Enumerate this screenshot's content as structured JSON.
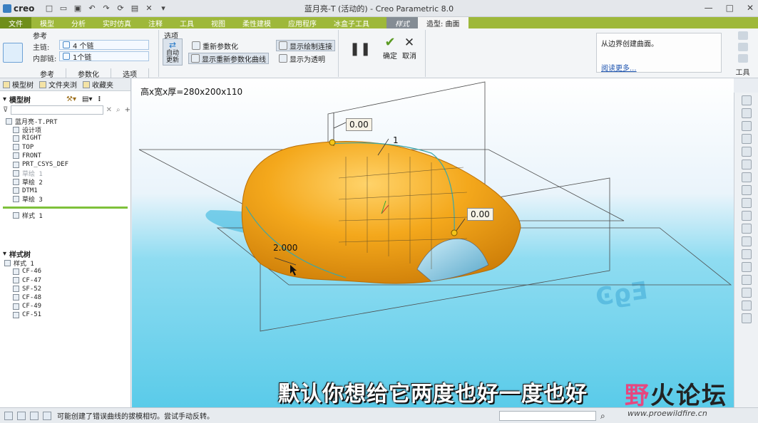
{
  "app": {
    "logo": "creo",
    "window_title": "蓝月亮-T (活动的) - Creo Parametric 8.0"
  },
  "menu": {
    "items": [
      "文件",
      "模型",
      "分析",
      "实时仿真",
      "注释",
      "工具",
      "视图",
      "柔性建模",
      "应用程序",
      "冰盒子工具"
    ],
    "style_tab": "样式",
    "active_tab": "造型: 曲面"
  },
  "ribbon": {
    "reference": {
      "title": "参考",
      "main_chain_label": "主链:",
      "main_chain_value": "4 个链",
      "inner_chain_label": "内部链:",
      "inner_chain_value": "1个链"
    },
    "options": {
      "title": "选项",
      "auto_update": "自动更新",
      "reparam": "重新参数化",
      "show_reparam_curves": "显示重新参数化曲线",
      "show_draw_connection": "显示绘制连接",
      "show_transparent": "显示为透明"
    },
    "ok_label": "确定",
    "cancel_label": "取消",
    "bottom_tabs": [
      "参考",
      "参数化",
      "选项"
    ],
    "help_text": "从边界创建曲面。",
    "help_link": "阅读更多...",
    "tools_label": "工具"
  },
  "left_panel": {
    "tabs": [
      "模型树",
      "文件夹浏",
      "收藏夹"
    ],
    "model_tree_title": "模型树",
    "model_tree": [
      {
        "label": "蓝月亮-T.PRT",
        "dim": false
      },
      {
        "label": "设计项",
        "dim": false
      },
      {
        "label": "RIGHT",
        "dim": false
      },
      {
        "label": "TOP",
        "dim": false
      },
      {
        "label": "FRONT",
        "dim": false
      },
      {
        "label": "PRT_CSYS_DEF",
        "dim": false
      },
      {
        "label": "草绘 1",
        "dim": true
      },
      {
        "label": "草绘 2",
        "dim": false
      },
      {
        "label": "DTM1",
        "dim": false
      },
      {
        "label": "草绘 3",
        "dim": false
      }
    ],
    "active_feature": "样式 1",
    "style_tree_title": "样式树",
    "style_tree": [
      "样式 1",
      "CF-46",
      "CF-47",
      "SF-52",
      "CF-48",
      "CF-49",
      "CF-51"
    ]
  },
  "viewport": {
    "dimension_caption": "高x宽x厚=280x200x110",
    "labels": {
      "top_value": "0.00",
      "one": "1",
      "right_value": "0.00",
      "left_value": "2.000"
    },
    "subtitle": "默认你想给它两度也好一度也好"
  },
  "watermark": {
    "prefix": "野",
    "rest": "火论坛",
    "url": "www.proewildfire.cn"
  },
  "status": {
    "message": "可能创建了错误曲线的拔模相切。尝试手动反转。"
  },
  "colors": {
    "menu_green": "#9eb83a",
    "surface_orange": "#f2a31c",
    "floor_cyan": "#6fd7ef"
  }
}
